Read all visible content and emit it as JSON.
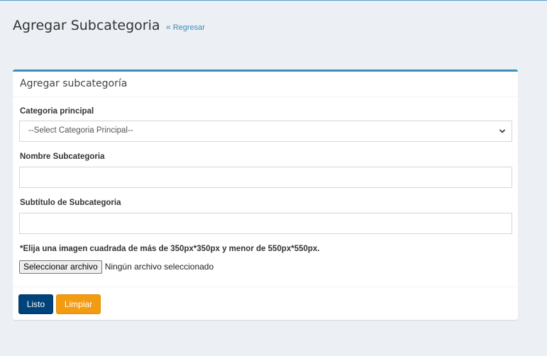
{
  "header": {
    "title": "Agregar Subcategoria",
    "back_arrows": "«",
    "back_label": "Regresar"
  },
  "box": {
    "title": "Agregar subcategoría"
  },
  "form": {
    "parent_category": {
      "label": "Categoria principal",
      "selected": "--Select Categoria Principal--"
    },
    "name": {
      "label": "Nombre Subcategoria",
      "value": ""
    },
    "subtitle": {
      "label": "Subtítulo de Subcategoria",
      "value": ""
    },
    "image": {
      "hint": "*Elija una imagen cuadrada de más de 350px*350px y menor de 550px*550px.",
      "button_label": "Seleccionar archivo",
      "status": "Ningún archivo seleccionado"
    }
  },
  "footer": {
    "submit_label": "Listo",
    "reset_label": "Limpiar"
  },
  "colors": {
    "background": "#ecf0f5",
    "accent": "#3c8dbc",
    "primary_button": "#00437a",
    "warning_button": "#f39c12"
  }
}
